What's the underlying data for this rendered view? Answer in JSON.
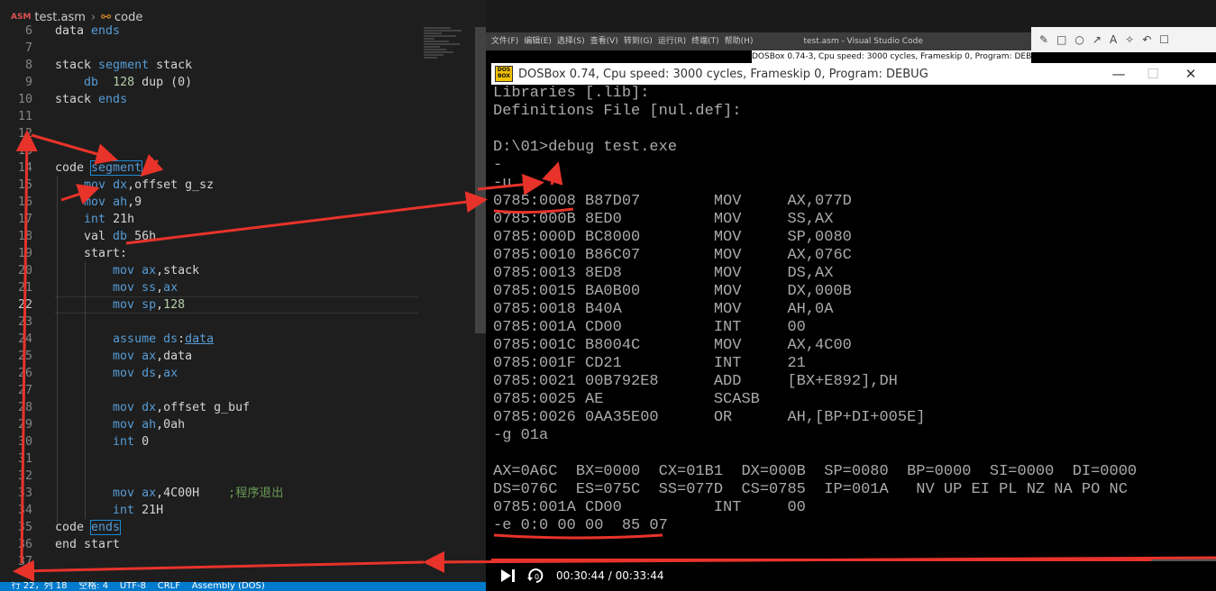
{
  "editor": {
    "breadcrumb": {
      "file_icon": "ASM",
      "file": "test.asm",
      "symbol": "code"
    },
    "lines": [
      {
        "n": "6",
        "segs": [
          [
            "",
            "data "
          ],
          [
            "kw",
            "ends"
          ]
        ]
      },
      {
        "n": "7",
        "segs": []
      },
      {
        "n": "8",
        "segs": [
          [
            "",
            "stack "
          ],
          [
            "kw",
            "segment"
          ],
          [
            "",
            " stack"
          ]
        ]
      },
      {
        "n": "9",
        "segs": [
          [
            "",
            "    "
          ],
          [
            "kw",
            "db"
          ],
          [
            "",
            "  "
          ],
          [
            "num",
            "128"
          ],
          [
            "",
            " dup (0)"
          ]
        ]
      },
      {
        "n": "10",
        "segs": [
          [
            "",
            "stack "
          ],
          [
            "kw",
            "ends"
          ]
        ]
      },
      {
        "n": "11",
        "segs": []
      },
      {
        "n": "12",
        "segs": []
      },
      {
        "n": "13",
        "segs": []
      },
      {
        "n": "14",
        "segs": [
          [
            "",
            "code "
          ],
          [
            "kw hl",
            "segment"
          ]
        ]
      },
      {
        "n": "15",
        "segs": [
          [
            "",
            "    "
          ],
          [
            "kw",
            "mov"
          ],
          [
            "",
            " "
          ],
          [
            "kw",
            "dx"
          ],
          [
            "",
            ",offset g_sz"
          ]
        ]
      },
      {
        "n": "16",
        "segs": [
          [
            "",
            "    "
          ],
          [
            "kw",
            "mov"
          ],
          [
            "",
            " "
          ],
          [
            "kw",
            "ah"
          ],
          [
            "",
            ",9"
          ]
        ]
      },
      {
        "n": "17",
        "segs": [
          [
            "",
            "    "
          ],
          [
            "kw",
            "int"
          ],
          [
            "",
            " 21h"
          ]
        ]
      },
      {
        "n": "18",
        "segs": [
          [
            "",
            "    val "
          ],
          [
            "kw",
            "db"
          ],
          [
            "",
            " 56h"
          ]
        ]
      },
      {
        "n": "19",
        "segs": [
          [
            "",
            "    start:"
          ]
        ]
      },
      {
        "n": "20",
        "segs": [
          [
            "",
            "        "
          ],
          [
            "kw",
            "mov"
          ],
          [
            "",
            " "
          ],
          [
            "kw",
            "ax"
          ],
          [
            "",
            ",stack"
          ]
        ]
      },
      {
        "n": "21",
        "segs": [
          [
            "",
            "        "
          ],
          [
            "kw",
            "mov"
          ],
          [
            "",
            " "
          ],
          [
            "kw",
            "ss"
          ],
          [
            "",
            ","
          ],
          [
            "kw",
            "ax"
          ]
        ]
      },
      {
        "n": "22",
        "segs": [
          [
            "",
            "        "
          ],
          [
            "kw",
            "mov"
          ],
          [
            "",
            " "
          ],
          [
            "kw",
            "sp"
          ],
          [
            "",
            ","
          ],
          [
            "num",
            "128"
          ]
        ]
      },
      {
        "n": "23",
        "segs": []
      },
      {
        "n": "24",
        "segs": [
          [
            "",
            "        "
          ],
          [
            "kw",
            "assume"
          ],
          [
            "",
            " "
          ],
          [
            "kw",
            "ds"
          ],
          [
            "",
            ":"
          ],
          [
            "kw und",
            "data"
          ]
        ]
      },
      {
        "n": "25",
        "segs": [
          [
            "",
            "        "
          ],
          [
            "kw",
            "mov"
          ],
          [
            "",
            " "
          ],
          [
            "kw",
            "ax"
          ],
          [
            "",
            ",data"
          ]
        ]
      },
      {
        "n": "26",
        "segs": [
          [
            "",
            "        "
          ],
          [
            "kw",
            "mov"
          ],
          [
            "",
            " "
          ],
          [
            "kw",
            "ds"
          ],
          [
            "",
            ","
          ],
          [
            "kw",
            "ax"
          ]
        ]
      },
      {
        "n": "27",
        "segs": []
      },
      {
        "n": "28",
        "segs": [
          [
            "",
            "        "
          ],
          [
            "kw",
            "mov"
          ],
          [
            "",
            " "
          ],
          [
            "kw",
            "dx"
          ],
          [
            "",
            ",offset g_buf"
          ]
        ]
      },
      {
        "n": "29",
        "segs": [
          [
            "",
            "        "
          ],
          [
            "kw",
            "mov"
          ],
          [
            "",
            " "
          ],
          [
            "kw",
            "ah"
          ],
          [
            "",
            ",0ah"
          ]
        ]
      },
      {
        "n": "30",
        "segs": [
          [
            "",
            "        "
          ],
          [
            "kw",
            "int"
          ],
          [
            "",
            " 0"
          ]
        ]
      },
      {
        "n": "31",
        "segs": []
      },
      {
        "n": "32",
        "segs": []
      },
      {
        "n": "33",
        "segs": [
          [
            "",
            "        "
          ],
          [
            "kw",
            "mov"
          ],
          [
            "",
            " "
          ],
          [
            "kw",
            "ax"
          ],
          [
            "",
            ",4C00H    "
          ],
          [
            "cm",
            ";程序退出"
          ]
        ]
      },
      {
        "n": "34",
        "segs": [
          [
            "",
            "        "
          ],
          [
            "kw",
            "int"
          ],
          [
            "",
            " 21H"
          ]
        ]
      },
      {
        "n": "35",
        "segs": [
          [
            "",
            "code "
          ],
          [
            "kw hl",
            "ends"
          ]
        ]
      },
      {
        "n": "36",
        "segs": [
          [
            "",
            "end start"
          ]
        ]
      },
      {
        "n": "37",
        "segs": []
      }
    ],
    "current_line": "22",
    "statusbar": "    行 22，列 18    空格: 4    UTF-8    CRLF    Assembly (DOS)"
  },
  "vscode_titlebar": {
    "menu": [
      "文件(F)",
      "编辑(E)",
      "选择(S)",
      "查看(V)",
      "转到(G)",
      "运行(R)",
      "终端(T)",
      "帮助(H)"
    ],
    "title": "test.asm - Visual Studio Code"
  },
  "mini_dosbox_title": "DOSBox 0.74-3, Cpu speed:    3000 cycles, Frameskip  0, Program:   DEBUG",
  "annotation_toolbar": [
    "✎",
    "□",
    "○",
    "↗",
    "A",
    "✧",
    "↶",
    "☐"
  ],
  "dosbox": {
    "icon_text": "DOS BOX",
    "title": "DOSBox 0.74, Cpu speed:     3000 cycles, Frameskip  0, Program:    DEBUG",
    "minimize": "—",
    "maximize": "☐",
    "close": "✕",
    "lines": [
      "Libraries [.lib]:",
      "Definitions File [nul.def]:",
      "",
      "D:\\01>debug test.exe",
      "-",
      "-u",
      "0785:0008 B87D07        MOV     AX,077D",
      "0785:000B 8ED0          MOV     SS,AX",
      "0785:000D BC8000        MOV     SP,0080",
      "0785:0010 B86C07        MOV     AX,076C",
      "0785:0013 8ED8          MOV     DS,AX",
      "0785:0015 BA0B00        MOV     DX,000B",
      "0785:0018 B40A          MOV     AH,0A",
      "0785:001A CD00          INT     00",
      "0785:001C B8004C        MOV     AX,4C00",
      "0785:001F CD21          INT     21",
      "0785:0021 00B792E8      ADD     [BX+E892],DH",
      "0785:0025 AE            SCASB",
      "0785:0026 0AA35E00      OR      AH,[BP+DI+005E]",
      "-g 01a",
      "",
      "AX=0A6C  BX=0000  CX=01B1  DX=000B  SP=0080  BP=0000  SI=0000  DI=0000",
      "DS=076C  ES=075C  SS=077D  CS=0785  IP=001A   NV UP EI PL NZ NA PO NC",
      "0785:001A CD00          INT     00",
      "-e 0:0 00 00  85 07"
    ]
  },
  "player": {
    "time": "00:30:44 / 00:33:44",
    "progress": 0.911
  },
  "colors": {
    "editor_bg": "#1e1e1e",
    "keyword": "#569cd6",
    "number": "#b5cea8",
    "comment": "#6a9955",
    "dos_text": "#aaaaaa",
    "annotation_red": "#e8332a",
    "status_blue": "#007acc"
  }
}
